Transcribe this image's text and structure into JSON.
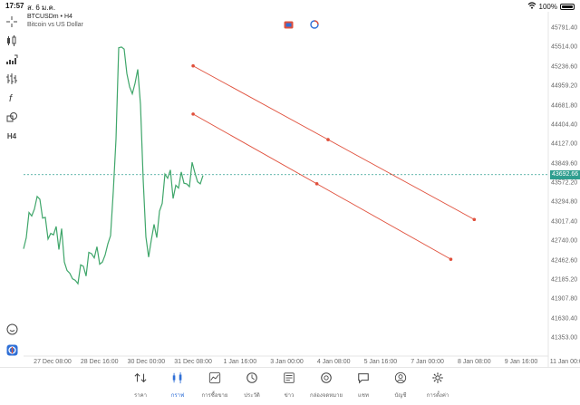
{
  "status": {
    "time": "17:57",
    "date": "ส. 6 ม.ค.",
    "battery": "100%"
  },
  "chart": {
    "symbol": "BTCUSDm • H4",
    "description": "Bitcoin vs US Dollar",
    "current_price": "43692.66",
    "price_labels": [
      "45791.40",
      "45514.00",
      "45236.60",
      "44959.20",
      "44681.80",
      "44404.40",
      "44127.00",
      "43849.60",
      "43572.20",
      "43294.80",
      "43017.40",
      "42740.00",
      "42462.60",
      "42185.20",
      "41907.80",
      "41630.40",
      "41353.00"
    ],
    "time_labels": [
      "27 Dec 08:00",
      "28 Dec 16:00",
      "30 Dec 00:00",
      "31 Dec 08:00",
      "1 Jan 16:00",
      "3 Jan 00:00",
      "4 Jan 08:00",
      "5 Jan 16:00",
      "7 Jan 00:00",
      "8 Jan 08:00",
      "9 Jan 16:00",
      "11 Jan 00:00"
    ],
    "line_color": "#3fa66a",
    "channel_color": "#e0503c",
    "price_line_color": "#2f9e8f"
  },
  "chart_data": {
    "type": "line",
    "series": [
      {
        "values": [
          42630,
          42790,
          43150,
          43100,
          43200,
          43380,
          43340,
          43070,
          43080,
          42770,
          42850,
          42830,
          42950,
          42620,
          42920,
          42440,
          42320,
          42280,
          42200,
          42180,
          42130,
          42400,
          42380,
          42240,
          42580,
          42560,
          42500,
          42660,
          42410,
          42440,
          42540,
          42700,
          42820,
          43450,
          44200,
          45510,
          45520,
          45490,
          45140,
          44950,
          44850,
          45000,
          45200,
          44700,
          43620,
          42800,
          42510,
          42760,
          42980,
          42790,
          43170,
          43280,
          43700,
          43640,
          43760,
          43350,
          43540,
          43500,
          43730,
          43570,
          43560,
          43520,
          43870,
          43720,
          43590,
          43560,
          43680
        ]
      }
    ],
    "channels": [
      {
        "start": {
          "date": "31 Dec 08:00",
          "price": 45250
        },
        "end": {
          "date": "8 Jan 08:00",
          "price": 43050
        }
      },
      {
        "start": {
          "date": "31 Dec 08:00",
          "price": 44560
        },
        "end": {
          "date": "7 Jan 16:00",
          "price": 42480
        }
      }
    ],
    "ylim": [
      41353,
      45791.4
    ]
  },
  "left_tools": [
    "crosshair-icon",
    "candles-icon",
    "indicators-icon",
    "bars-icon",
    "function-icon",
    "shapes-icon",
    "timeframe-label",
    "zoom-icon",
    "app-logo-icon"
  ],
  "timeframe": "H4",
  "nav": [
    {
      "label": "ราคา",
      "icon": "quotes-icon"
    },
    {
      "label": "กราฟ",
      "icon": "chart-icon",
      "active": true
    },
    {
      "label": "การซื้อขาย",
      "icon": "trade-icon"
    },
    {
      "label": "ประวัติ",
      "icon": "history-icon"
    },
    {
      "label": "ข่าว",
      "icon": "news-icon"
    },
    {
      "label": "กล่องจดหมาย",
      "icon": "mailbox-icon"
    },
    {
      "label": "แชท",
      "icon": "chat-icon"
    },
    {
      "label": "บัญชี",
      "icon": "account-icon"
    },
    {
      "label": "การตั้งค่า",
      "icon": "settings-icon"
    }
  ]
}
